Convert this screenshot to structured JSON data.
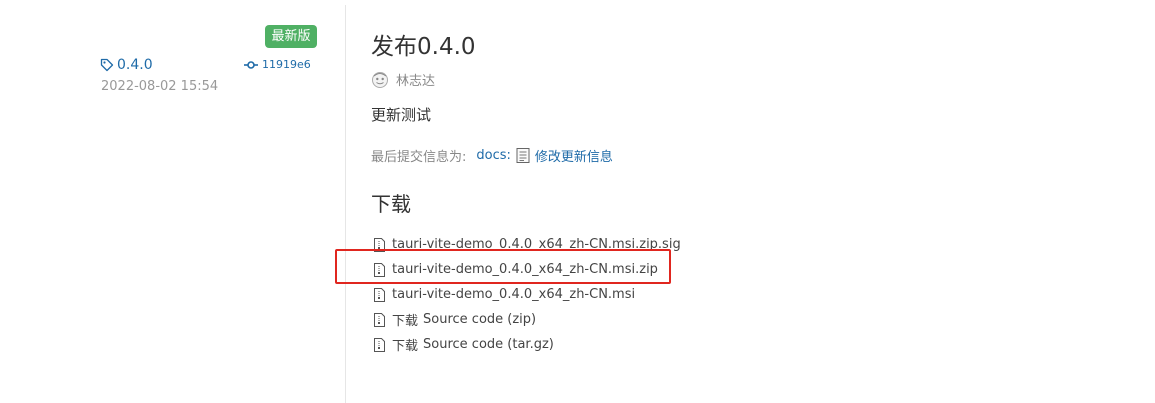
{
  "release": {
    "badge": "最新版",
    "tag": "0.4.0",
    "commit_hash": "11919e6",
    "date": "2022-08-02 15:54",
    "title": "发布0.4.0",
    "author": "林志达",
    "description": "更新测试",
    "last_commit_label": "最后提交信息为:",
    "last_commit_type": "docs:",
    "last_commit_message": "修改更新信息"
  },
  "downloads": {
    "heading": "下载",
    "files": [
      {
        "name": "tauri-vite-demo_0.4.0_x64_zh-CN.msi.zip.sig",
        "prefix": ""
      },
      {
        "name": "tauri-vite-demo_0.4.0_x64_zh-CN.msi.zip",
        "prefix": ""
      },
      {
        "name": "tauri-vite-demo_0.4.0_x64_zh-CN.msi",
        "prefix": ""
      },
      {
        "name": "Source code (zip)",
        "prefix": "下载"
      },
      {
        "name": "Source code (tar.gz)",
        "prefix": "下载"
      }
    ]
  },
  "colors": {
    "link": "#1f6ba8",
    "badge_bg": "#4fb064",
    "highlight": "#e0261f"
  },
  "icons": {
    "tag": "tag-icon",
    "commit": "commit-icon",
    "avatar": "avatar-icon",
    "memo": "memo-icon",
    "file": "file-zip-icon"
  }
}
